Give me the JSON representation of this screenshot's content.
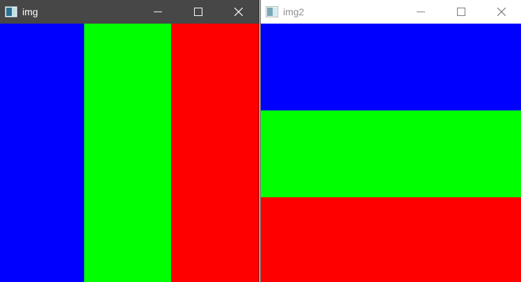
{
  "windows": [
    {
      "title": "img",
      "active": true,
      "stripe_direction": "vertical",
      "stripes": [
        {
          "color": "#0000ff"
        },
        {
          "color": "#00ff00"
        },
        {
          "color": "#ff0000"
        }
      ]
    },
    {
      "title": "img2",
      "active": false,
      "stripe_direction": "horizontal",
      "stripes": [
        {
          "color": "#0000ff"
        },
        {
          "color": "#00ff00"
        },
        {
          "color": "#ff0000"
        }
      ]
    }
  ],
  "controls": {
    "minimize_icon": "minimize-icon",
    "maximize_icon": "maximize-icon",
    "close_icon": "close-icon"
  },
  "app_icon": "app-window-icon"
}
